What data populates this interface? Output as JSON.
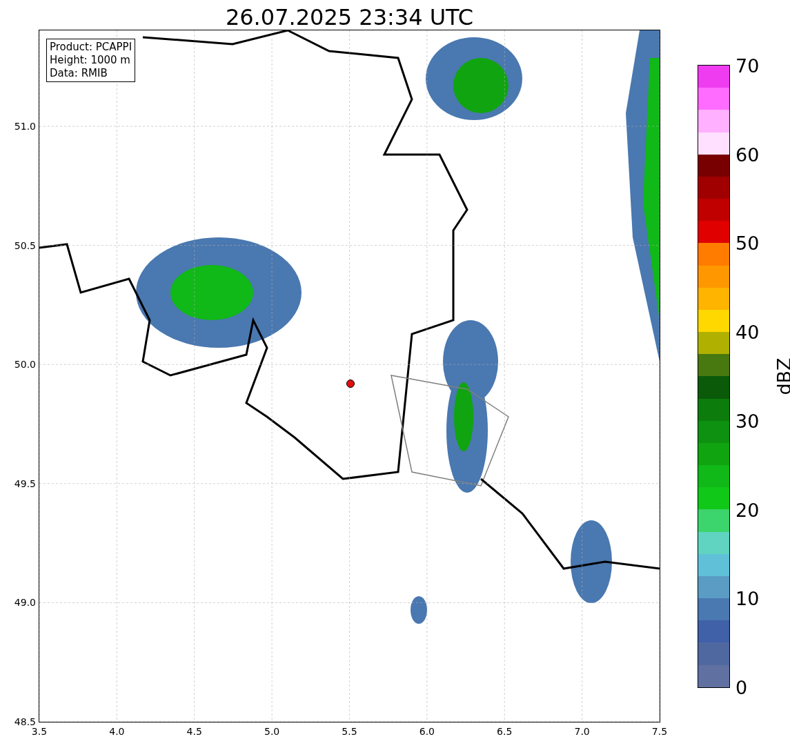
{
  "title": "26.07.2025 23:34 UTC",
  "info_box": [
    "Product: PCAPPI",
    "Height: 1000 m",
    "Data: RMIB"
  ],
  "map": {
    "xticks": [
      "3.5",
      "4.0",
      "4.5",
      "5.0",
      "5.5",
      "6.0",
      "6.5",
      "7.0",
      "7.5"
    ],
    "yticks": [
      "51.0",
      "50.5",
      "50.0",
      "49.5",
      "49.0",
      "48.5"
    ]
  },
  "colorbar": {
    "label": "dBZ",
    "ticks": [
      "70",
      "60",
      "50",
      "40",
      "30",
      "20",
      "10",
      "0"
    ],
    "bins": [
      {
        "color": "#f03cf0"
      },
      {
        "color": "#ff6cff"
      },
      {
        "color": "#ffb0ff"
      },
      {
        "color": "#ffe0ff"
      },
      {
        "color": "#780000"
      },
      {
        "color": "#a00000"
      },
      {
        "color": "#c00000"
      },
      {
        "color": "#e00000"
      },
      {
        "color": "#ff7c00"
      },
      {
        "color": "#ff9800"
      },
      {
        "color": "#ffb400"
      },
      {
        "color": "#ffd800"
      },
      {
        "color": "#b0b000"
      },
      {
        "color": "#487810"
      },
      {
        "color": "#0a5a0a"
      },
      {
        "color": "#0c7c0c"
      },
      {
        "color": "#0e9010"
      },
      {
        "color": "#10a410"
      },
      {
        "color": "#10b818"
      },
      {
        "color": "#10c818"
      },
      {
        "color": "#3cd46c"
      },
      {
        "color": "#60d4c0"
      },
      {
        "color": "#60c0d8"
      },
      {
        "color": "#5a9cc4"
      },
      {
        "color": "#4a78b0"
      },
      {
        "color": "#4060a8"
      },
      {
        "color": "#5068a0"
      },
      {
        "color": "#6070a0"
      }
    ]
  }
}
